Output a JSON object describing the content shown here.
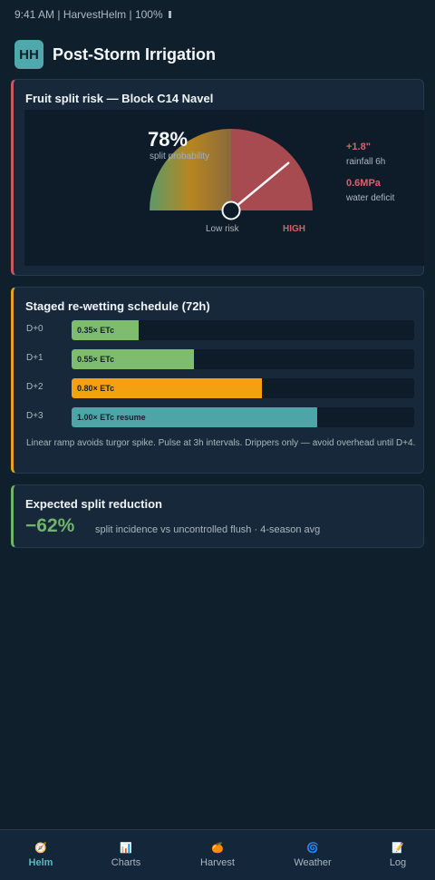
{
  "status_bar": {
    "text": "9:41 AM | HarvestHelm | 100%"
  },
  "header": {
    "logo_text": "HH",
    "title": "Post-Storm Irrigation"
  },
  "risk_card": {
    "title": "Fruit split risk — Block C14 Navel",
    "probability_percent": 78,
    "probability_value": "78%",
    "probability_label": "split probability",
    "low_label": "Low risk",
    "high_label": "HIGH",
    "metrics": [
      {
        "value": "+1.8\"",
        "label": "rainfall 6h"
      },
      {
        "value": "0.6MPa",
        "label": "water deficit"
      }
    ],
    "colors": {
      "low": "#5d9a6a",
      "mid": "#b7861f",
      "high": "#a84b50",
      "accent": "#c65a61"
    }
  },
  "schedule_card": {
    "title": "Staged re-wetting schedule (72h)",
    "rows": [
      {
        "day": "D+0",
        "label": "0.35× ETc",
        "fraction": 0.195,
        "color": "#7ebd6e"
      },
      {
        "day": "D+1",
        "label": "0.55× ETc",
        "fraction": 0.357,
        "color": "#7ebd6e"
      },
      {
        "day": "D+2",
        "label": "0.80× ETc",
        "fraction": 0.556,
        "color": "#f5a00f"
      },
      {
        "day": "D+3",
        "label": "1.00× ETc resume",
        "fraction": 0.717,
        "color": "#4ea5a7"
      }
    ],
    "note": "Linear ramp avoids turgor spike. Pulse at 3h intervals. Drippers only — avoid overhead until D+4."
  },
  "reduction_card": {
    "title": "Expected split reduction",
    "value": "−62%",
    "description": "split incidence vs uncontrolled flush · 4-season avg"
  },
  "bottom_nav": {
    "items": [
      {
        "label": "Helm",
        "icon": "compass-icon",
        "glyph": "🧭",
        "active": true
      },
      {
        "label": "Charts",
        "icon": "chart-icon",
        "glyph": "📊",
        "active": false
      },
      {
        "label": "Harvest",
        "icon": "orange-icon",
        "glyph": "🍊",
        "active": false
      },
      {
        "label": "Weather",
        "icon": "cyclone-icon",
        "glyph": "🌀",
        "active": false
      },
      {
        "label": "Log",
        "icon": "memo-icon",
        "glyph": "📝",
        "active": false
      }
    ]
  }
}
